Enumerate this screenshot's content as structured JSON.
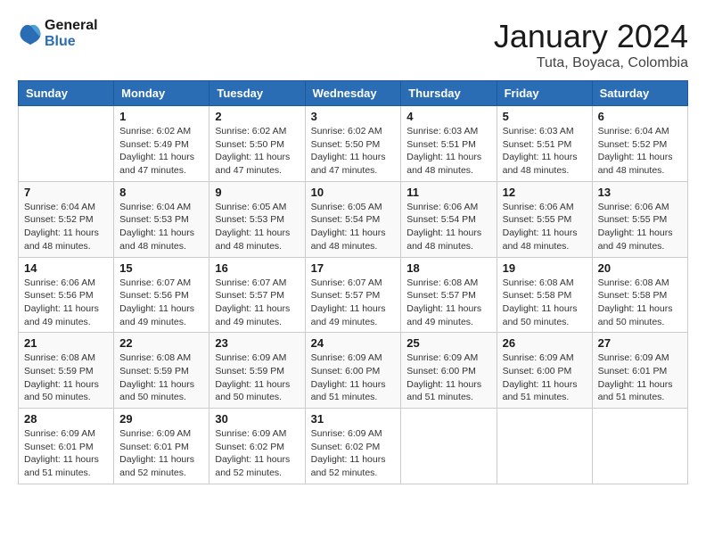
{
  "header": {
    "logo_line1": "General",
    "logo_line2": "Blue",
    "month": "January 2024",
    "location": "Tuta, Boyaca, Colombia"
  },
  "days_of_week": [
    "Sunday",
    "Monday",
    "Tuesday",
    "Wednesday",
    "Thursday",
    "Friday",
    "Saturday"
  ],
  "weeks": [
    [
      {
        "day": "",
        "sunrise": "",
        "sunset": "",
        "daylight": ""
      },
      {
        "day": "1",
        "sunrise": "Sunrise: 6:02 AM",
        "sunset": "Sunset: 5:49 PM",
        "daylight": "Daylight: 11 hours and 47 minutes."
      },
      {
        "day": "2",
        "sunrise": "Sunrise: 6:02 AM",
        "sunset": "Sunset: 5:50 PM",
        "daylight": "Daylight: 11 hours and 47 minutes."
      },
      {
        "day": "3",
        "sunrise": "Sunrise: 6:02 AM",
        "sunset": "Sunset: 5:50 PM",
        "daylight": "Daylight: 11 hours and 47 minutes."
      },
      {
        "day": "4",
        "sunrise": "Sunrise: 6:03 AM",
        "sunset": "Sunset: 5:51 PM",
        "daylight": "Daylight: 11 hours and 48 minutes."
      },
      {
        "day": "5",
        "sunrise": "Sunrise: 6:03 AM",
        "sunset": "Sunset: 5:51 PM",
        "daylight": "Daylight: 11 hours and 48 minutes."
      },
      {
        "day": "6",
        "sunrise": "Sunrise: 6:04 AM",
        "sunset": "Sunset: 5:52 PM",
        "daylight": "Daylight: 11 hours and 48 minutes."
      }
    ],
    [
      {
        "day": "7",
        "sunrise": "Sunrise: 6:04 AM",
        "sunset": "Sunset: 5:52 PM",
        "daylight": "Daylight: 11 hours and 48 minutes."
      },
      {
        "day": "8",
        "sunrise": "Sunrise: 6:04 AM",
        "sunset": "Sunset: 5:53 PM",
        "daylight": "Daylight: 11 hours and 48 minutes."
      },
      {
        "day": "9",
        "sunrise": "Sunrise: 6:05 AM",
        "sunset": "Sunset: 5:53 PM",
        "daylight": "Daylight: 11 hours and 48 minutes."
      },
      {
        "day": "10",
        "sunrise": "Sunrise: 6:05 AM",
        "sunset": "Sunset: 5:54 PM",
        "daylight": "Daylight: 11 hours and 48 minutes."
      },
      {
        "day": "11",
        "sunrise": "Sunrise: 6:06 AM",
        "sunset": "Sunset: 5:54 PM",
        "daylight": "Daylight: 11 hours and 48 minutes."
      },
      {
        "day": "12",
        "sunrise": "Sunrise: 6:06 AM",
        "sunset": "Sunset: 5:55 PM",
        "daylight": "Daylight: 11 hours and 48 minutes."
      },
      {
        "day": "13",
        "sunrise": "Sunrise: 6:06 AM",
        "sunset": "Sunset: 5:55 PM",
        "daylight": "Daylight: 11 hours and 49 minutes."
      }
    ],
    [
      {
        "day": "14",
        "sunrise": "Sunrise: 6:06 AM",
        "sunset": "Sunset: 5:56 PM",
        "daylight": "Daylight: 11 hours and 49 minutes."
      },
      {
        "day": "15",
        "sunrise": "Sunrise: 6:07 AM",
        "sunset": "Sunset: 5:56 PM",
        "daylight": "Daylight: 11 hours and 49 minutes."
      },
      {
        "day": "16",
        "sunrise": "Sunrise: 6:07 AM",
        "sunset": "Sunset: 5:57 PM",
        "daylight": "Daylight: 11 hours and 49 minutes."
      },
      {
        "day": "17",
        "sunrise": "Sunrise: 6:07 AM",
        "sunset": "Sunset: 5:57 PM",
        "daylight": "Daylight: 11 hours and 49 minutes."
      },
      {
        "day": "18",
        "sunrise": "Sunrise: 6:08 AM",
        "sunset": "Sunset: 5:57 PM",
        "daylight": "Daylight: 11 hours and 49 minutes."
      },
      {
        "day": "19",
        "sunrise": "Sunrise: 6:08 AM",
        "sunset": "Sunset: 5:58 PM",
        "daylight": "Daylight: 11 hours and 50 minutes."
      },
      {
        "day": "20",
        "sunrise": "Sunrise: 6:08 AM",
        "sunset": "Sunset: 5:58 PM",
        "daylight": "Daylight: 11 hours and 50 minutes."
      }
    ],
    [
      {
        "day": "21",
        "sunrise": "Sunrise: 6:08 AM",
        "sunset": "Sunset: 5:59 PM",
        "daylight": "Daylight: 11 hours and 50 minutes."
      },
      {
        "day": "22",
        "sunrise": "Sunrise: 6:08 AM",
        "sunset": "Sunset: 5:59 PM",
        "daylight": "Daylight: 11 hours and 50 minutes."
      },
      {
        "day": "23",
        "sunrise": "Sunrise: 6:09 AM",
        "sunset": "Sunset: 5:59 PM",
        "daylight": "Daylight: 11 hours and 50 minutes."
      },
      {
        "day": "24",
        "sunrise": "Sunrise: 6:09 AM",
        "sunset": "Sunset: 6:00 PM",
        "daylight": "Daylight: 11 hours and 51 minutes."
      },
      {
        "day": "25",
        "sunrise": "Sunrise: 6:09 AM",
        "sunset": "Sunset: 6:00 PM",
        "daylight": "Daylight: 11 hours and 51 minutes."
      },
      {
        "day": "26",
        "sunrise": "Sunrise: 6:09 AM",
        "sunset": "Sunset: 6:00 PM",
        "daylight": "Daylight: 11 hours and 51 minutes."
      },
      {
        "day": "27",
        "sunrise": "Sunrise: 6:09 AM",
        "sunset": "Sunset: 6:01 PM",
        "daylight": "Daylight: 11 hours and 51 minutes."
      }
    ],
    [
      {
        "day": "28",
        "sunrise": "Sunrise: 6:09 AM",
        "sunset": "Sunset: 6:01 PM",
        "daylight": "Daylight: 11 hours and 51 minutes."
      },
      {
        "day": "29",
        "sunrise": "Sunrise: 6:09 AM",
        "sunset": "Sunset: 6:01 PM",
        "daylight": "Daylight: 11 hours and 52 minutes."
      },
      {
        "day": "30",
        "sunrise": "Sunrise: 6:09 AM",
        "sunset": "Sunset: 6:02 PM",
        "daylight": "Daylight: 11 hours and 52 minutes."
      },
      {
        "day": "31",
        "sunrise": "Sunrise: 6:09 AM",
        "sunset": "Sunset: 6:02 PM",
        "daylight": "Daylight: 11 hours and 52 minutes."
      },
      {
        "day": "",
        "sunrise": "",
        "sunset": "",
        "daylight": ""
      },
      {
        "day": "",
        "sunrise": "",
        "sunset": "",
        "daylight": ""
      },
      {
        "day": "",
        "sunrise": "",
        "sunset": "",
        "daylight": ""
      }
    ]
  ]
}
